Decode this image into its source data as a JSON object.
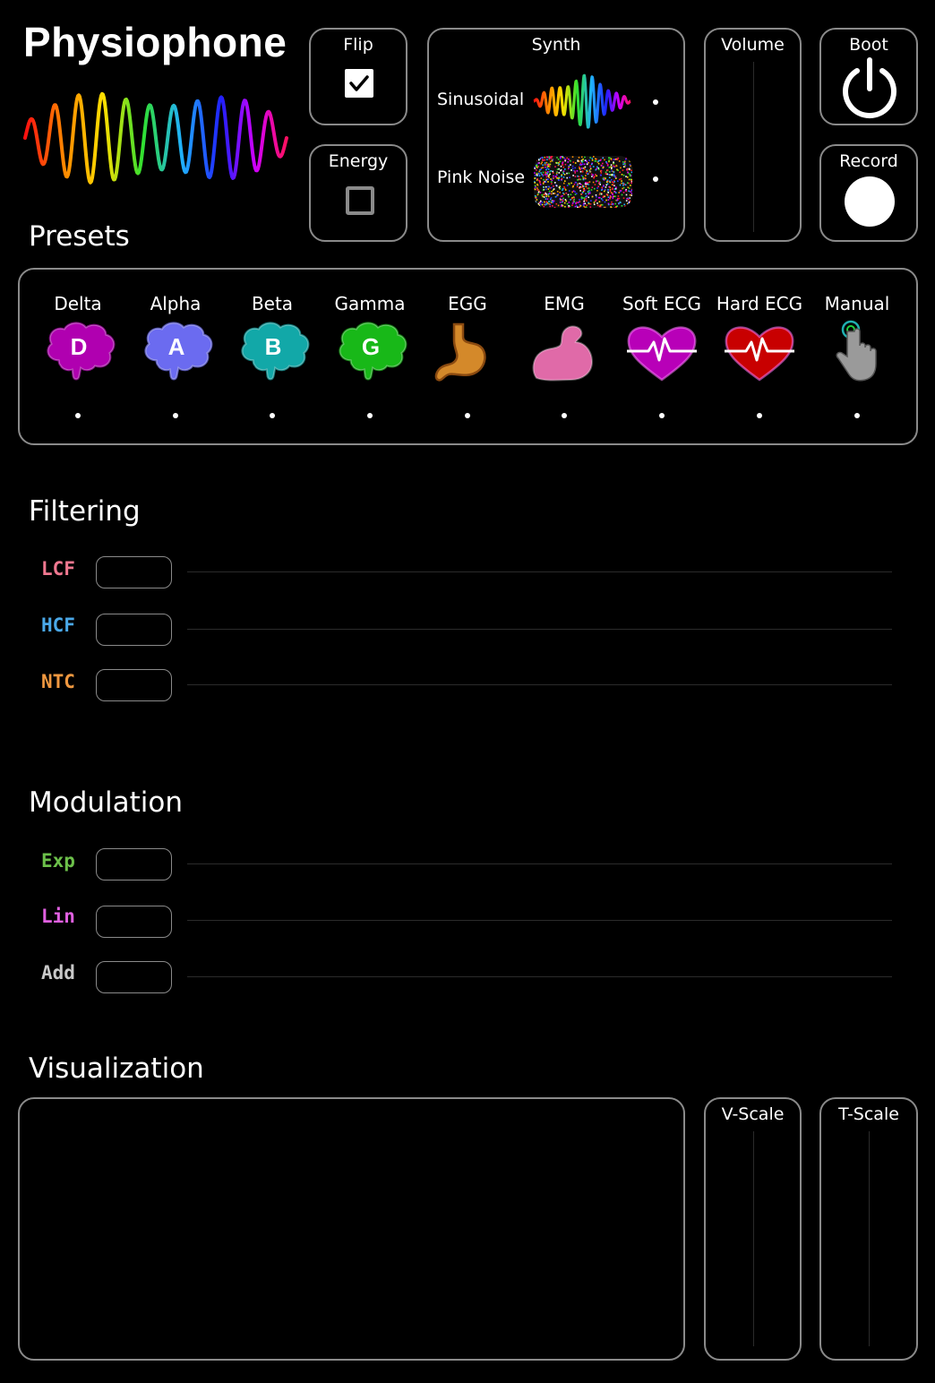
{
  "app": {
    "title": "Physiophone"
  },
  "controls": {
    "flip": {
      "label": "Flip",
      "checked": true
    },
    "energy": {
      "label": "Energy",
      "checked": false
    },
    "synth": {
      "label": "Synth",
      "options": [
        "Sinusoidal",
        "Pink Noise"
      ]
    },
    "volume": {
      "label": "Volume"
    },
    "boot": {
      "label": "Boot",
      "icon": "power-icon"
    },
    "record": {
      "label": "Record",
      "icon": "record-icon"
    }
  },
  "presets": {
    "heading": "Presets",
    "items": [
      {
        "label": "Delta",
        "letter": "D",
        "icon": "brain-icon",
        "color": "#b000b0"
      },
      {
        "label": "Alpha",
        "letter": "A",
        "icon": "brain-icon",
        "color": "#6b6bf0"
      },
      {
        "label": "Beta",
        "letter": "B",
        "icon": "brain-icon",
        "color": "#12a8a8"
      },
      {
        "label": "Gamma",
        "letter": "G",
        "icon": "brain-icon",
        "color": "#18b818"
      },
      {
        "label": "EGG",
        "letter": "",
        "icon": "stomach-icon",
        "color": "#d4892a"
      },
      {
        "label": "EMG",
        "letter": "",
        "icon": "muscle-arm-icon",
        "color": "#e06aa8"
      },
      {
        "label": "Soft ECG",
        "letter": "",
        "icon": "heart-pulse-icon",
        "color": "#b800b8"
      },
      {
        "label": "Hard ECG",
        "letter": "",
        "icon": "heart-pulse-icon",
        "color": "#c80000"
      },
      {
        "label": "Manual",
        "letter": "",
        "icon": "hand-pointer-icon",
        "color": "#9a9a9a"
      }
    ]
  },
  "filtering": {
    "heading": "Filtering",
    "params": [
      {
        "label": "LCF",
        "color": "#f07890"
      },
      {
        "label": "HCF",
        "color": "#4aa8e8"
      },
      {
        "label": "NTC",
        "color": "#f09840"
      }
    ]
  },
  "modulation": {
    "heading": "Modulation",
    "params": [
      {
        "label": "Exp",
        "color": "#6cc04a"
      },
      {
        "label": "Lin",
        "color": "#e060e0"
      },
      {
        "label": "Add",
        "color": "#c8c8c8"
      }
    ]
  },
  "visualization": {
    "heading": "Visualization",
    "v_scale": {
      "label": "V-Scale"
    },
    "t_scale": {
      "label": "T-Scale"
    }
  }
}
